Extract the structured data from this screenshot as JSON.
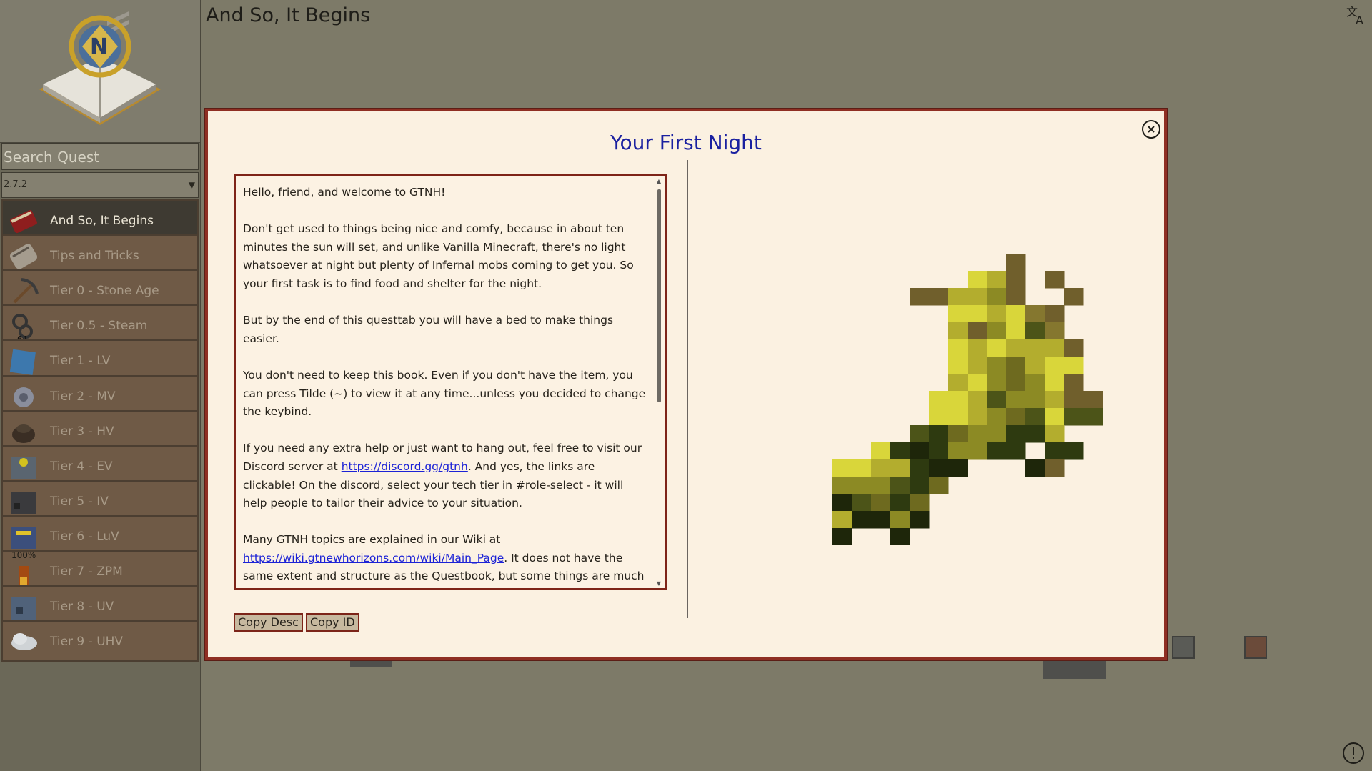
{
  "app": {
    "page_title": "And So, It Begins"
  },
  "sidebar": {
    "search_placeholder": "Search Quest",
    "version": "2.7.2",
    "items": [
      {
        "label": "And So, It Begins",
        "active": true,
        "icon": "red-book-icon"
      },
      {
        "label": "Tips and Tricks",
        "active": false,
        "icon": "scroll-icon"
      },
      {
        "label": "Tier 0 - Stone Age",
        "active": false,
        "icon": "pickaxe-icon"
      },
      {
        "label": "Tier 0.5 - Steam",
        "active": false,
        "icon": "steam-pipe-icon"
      },
      {
        "label": "Tier 1 - LV",
        "active": false,
        "icon": "blue-plate-icon"
      },
      {
        "label": "Tier 2 - MV",
        "active": false,
        "icon": "gear-icon"
      },
      {
        "label": "Tier 3 - HV",
        "active": false,
        "icon": "coil-icon"
      },
      {
        "label": "Tier 4 - EV",
        "active": false,
        "icon": "radiation-machine-icon"
      },
      {
        "label": "Tier 5 - IV",
        "active": false,
        "icon": "dark-machine-icon"
      },
      {
        "label": "Tier 6 - LuV",
        "active": false,
        "icon": "blue-machine-icon"
      },
      {
        "label": "Tier 7 - ZPM",
        "active": false,
        "icon": "zpm-icon",
        "badge": "100%"
      },
      {
        "label": "Tier 8 - UV",
        "active": false,
        "icon": "steel-machine-icon"
      },
      {
        "label": "Tier 9 - UHV",
        "active": false,
        "icon": "cloud-icon"
      }
    ]
  },
  "dialog": {
    "title": "Your First Night",
    "description": {
      "p1": "Hello, friend, and welcome to GTNH!",
      "p2": "Don't get used to things being nice and comfy, because in about ten minutes the sun will set, and unlike Vanilla Minecraft, there's no light whatsoever at night but plenty of Infernal mobs coming to get you. So your first task is to find food and shelter for the night.",
      "p3": "But by the end of this questtab you will have a bed to make things easier.",
      "p4": "You don't need to keep this book. Even if you don't have the item, you can press Tilde (~) to view it at any time...unless you decided to change the keybind.",
      "p5_pre": "If you need any extra help or just want to hang out, feel free to visit our Discord server at ",
      "p5_link": "https://discord.gg/gtnh",
      "p5_post": ". And yes, the links are clickable! On the discord, select your tech tier in #role-select - it will help people to tailor their advice to your situation.",
      "p6_pre": "Many GTNH topics are explained in our Wiki at ",
      "p6_link": "https://wiki.gtnewhorizons.com/wiki/Main_Page",
      "p6_post": ". It does not have the same extent and structure as the Questbook, but some things are much"
    },
    "buttons": {
      "copy_desc": "Copy Desc",
      "copy_id": "Copy ID"
    },
    "image_icon": "grass-fiber-icon"
  },
  "colors": {
    "background": "#7d7a68",
    "dialog_bg": "#fbf1e1",
    "dialog_border": "#8f2f23",
    "title": "#1a20a0",
    "link": "#1c22d6"
  }
}
